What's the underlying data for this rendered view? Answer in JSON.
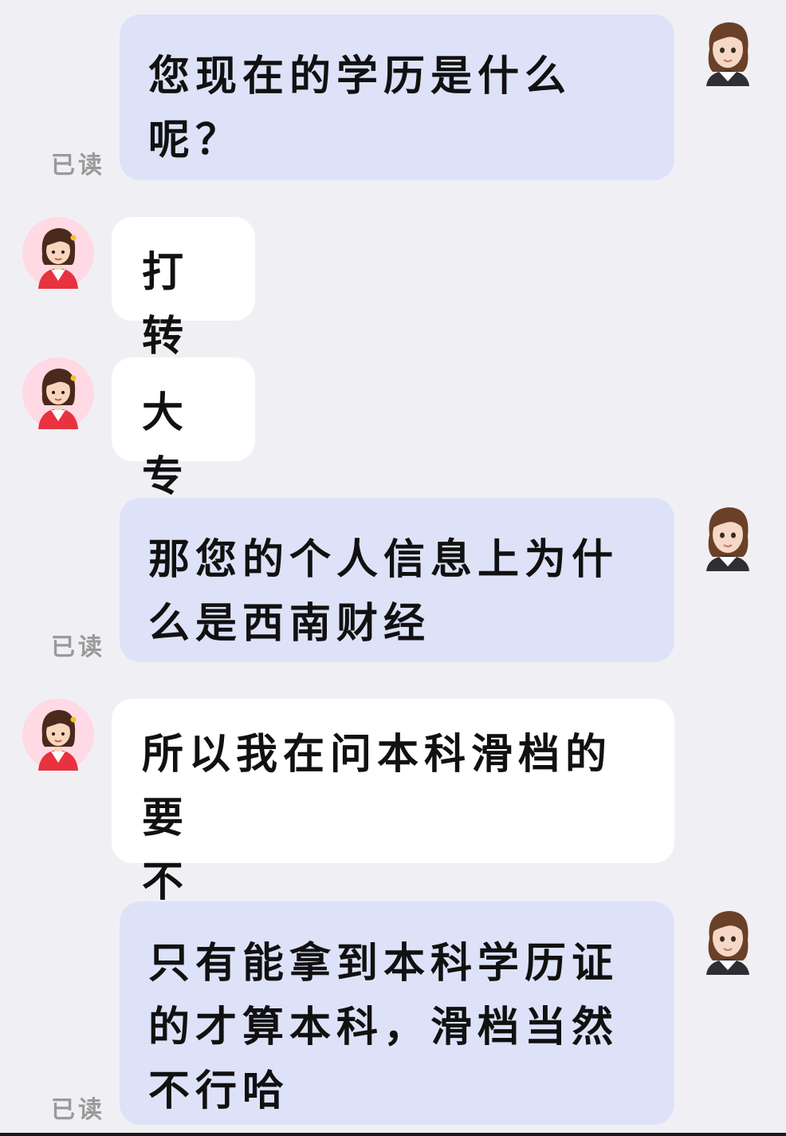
{
  "messages": [
    {
      "side": "right",
      "lines": [
        "您现在的学历是什么",
        "呢？"
      ],
      "status": "已读"
    },
    {
      "side": "left",
      "lines": [
        "打转"
      ]
    },
    {
      "side": "left",
      "lines": [
        "大专"
      ]
    },
    {
      "side": "right",
      "lines": [
        "那您的个人信息上为什",
        "么是西南财经"
      ],
      "status": "已读"
    },
    {
      "side": "left",
      "lines": [
        "所以我在问本科滑档的要",
        "不"
      ]
    },
    {
      "side": "right",
      "lines": [
        "只有能拿到本科学历证",
        "的才算本科，滑档当然",
        "不行哈"
      ],
      "status": "已读"
    }
  ],
  "colors": {
    "background": "#f0f0f4",
    "right_bubble": "#dde2f8",
    "left_bubble": "#ffffff",
    "read_text": "#9a9a9a"
  },
  "icons": {
    "agent_avatar": "woman-3d-avatar-icon",
    "user_avatar": "woman-cartoon-avatar-icon"
  }
}
